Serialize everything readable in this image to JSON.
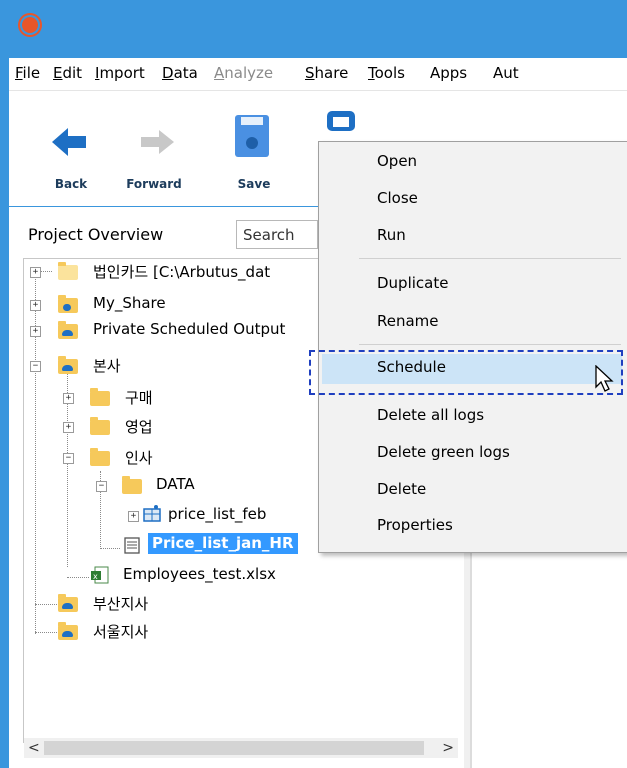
{
  "menubar": {
    "items": [
      {
        "label": "File",
        "hotkey": "F",
        "rest": "ile",
        "enabled": true
      },
      {
        "label": "Edit",
        "hotkey": "E",
        "rest": "dit",
        "enabled": true
      },
      {
        "label": "Import",
        "hotkey": "I",
        "rest": "mport",
        "enabled": true
      },
      {
        "label": "Data",
        "hotkey": "D",
        "rest": "ata",
        "enabled": true
      },
      {
        "label": "Analyze",
        "hotkey": "A",
        "rest": "nalyze",
        "enabled": false
      },
      {
        "label": "Share",
        "hotkey": "S",
        "rest": "hare",
        "enabled": true
      },
      {
        "label": "Tools",
        "hotkey": "T",
        "rest": "ools",
        "enabled": true
      },
      {
        "label": "Apps",
        "enabled": true
      },
      {
        "label": "Aut",
        "enabled": true
      }
    ]
  },
  "toolbar": {
    "back_label": "Back",
    "forward_label": "Forward",
    "save_label": "Save"
  },
  "panel": {
    "title": "Project Overview",
    "search_placeholder": "Search"
  },
  "tree": {
    "items": [
      {
        "label": "법인카드 [C:\\Arbutus_dat"
      },
      {
        "label": "My_Share"
      },
      {
        "label": "Private Scheduled Output"
      },
      {
        "label": "본사"
      },
      {
        "label": "구매"
      },
      {
        "label": "영업"
      },
      {
        "label": "인사"
      },
      {
        "label": "DATA"
      },
      {
        "label": "price_list_feb"
      },
      {
        "label": "Price_list_jan_HR"
      },
      {
        "label": "Employees_test.xlsx"
      },
      {
        "label": "부산지사"
      },
      {
        "label": "서울지사"
      }
    ]
  },
  "context_menu": {
    "items": [
      {
        "label": "Open"
      },
      {
        "label": "Close"
      },
      {
        "label": "Run"
      },
      {
        "label": "Duplicate"
      },
      {
        "label": "Rename"
      },
      {
        "label": "Schedule"
      },
      {
        "label": "Delete all logs"
      },
      {
        "label": "Delete green logs"
      },
      {
        "label": "Delete"
      },
      {
        "label": "Properties"
      }
    ],
    "highlighted": "Schedule"
  },
  "colors": {
    "title_bar": "#3a96dd",
    "accent_blue": "#1e6fc4",
    "selection": "#3399ff",
    "menu_highlight": "#cce4f7",
    "folder": "#f6c95b",
    "focus_box": "#1f3fbf"
  }
}
